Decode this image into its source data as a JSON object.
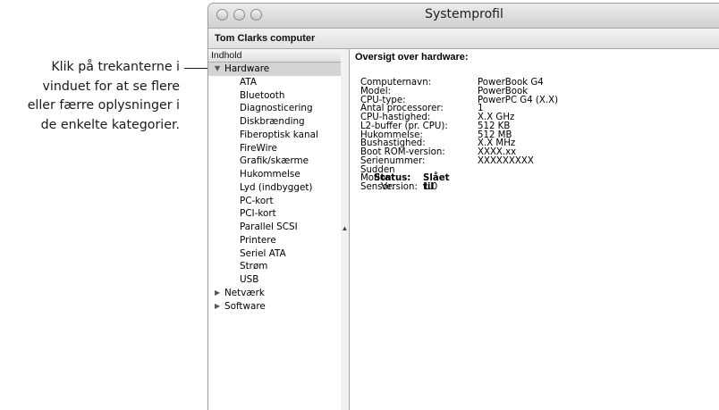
{
  "callout": {
    "lines": [
      "Klik på trekanterne i",
      "vinduet for at se flere",
      "eller færre oplysninger i",
      "de enkelte kategorier."
    ]
  },
  "window": {
    "title": "Systemprofil",
    "computer_name": "Tom Clarks computer"
  },
  "sidebar": {
    "header": "Indhold",
    "hardware_label": "Hardware",
    "hardware_items": [
      "ATA",
      "Bluetooth",
      "Diagnosticering",
      "Diskbrænding",
      "Fiberoptisk kanal",
      "FireWire",
      "Grafik/skærme",
      "Hukommelse",
      "Lyd (indbygget)",
      "PC-kort",
      "PCI-kort",
      "Parallel SCSI",
      "Printere",
      "Seriel ATA",
      "Strøm",
      "USB"
    ],
    "network_label": "Netværk",
    "software_label": "Software"
  },
  "overview": {
    "title": "Oversigt over hardware:",
    "rows": [
      {
        "label": "Computernavn:",
        "value": "PowerBook G4"
      },
      {
        "label": "Model:",
        "value": "PowerBook"
      },
      {
        "label": "CPU-type:",
        "value": "PowerPC G4 (X.X)"
      },
      {
        "label": "Antal processorer:",
        "value": "1"
      },
      {
        "label": "CPU-hastighed:",
        "value": "X.X GHz"
      },
      {
        "label": "L2-buffer (pr. CPU):",
        "value": "512 KB"
      },
      {
        "label": "Hukommelse:",
        "value": "512 MB"
      },
      {
        "label": "Bushastighed:",
        "value": "X.X MHz"
      },
      {
        "label": "Boot ROM-version:",
        "value": "XXXX.xx"
      },
      {
        "label": "Serienummer:",
        "value": "XXXXXXXXX"
      }
    ],
    "sms_label": "Sudden Motion Sensor:",
    "sms_status_label": "Status:",
    "sms_status_value": "Slået til",
    "sms_version_label": "Version:",
    "sms_version_value": "1.0"
  }
}
